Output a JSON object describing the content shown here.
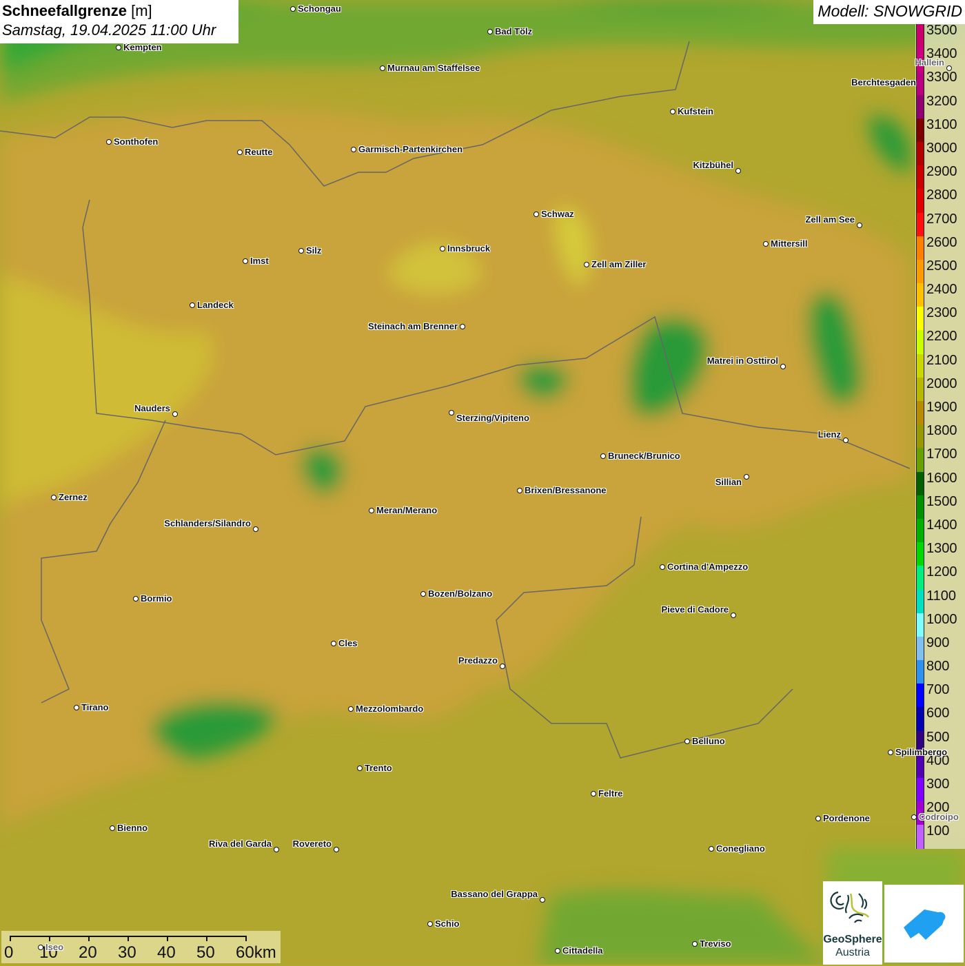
{
  "header": {
    "title_bold": "Schneefallgrenze",
    "title_unit": "[m]",
    "datetime": "Samstag, 19.04.2025 11:00 Uhr",
    "model": "Modell: SNOWGRID"
  },
  "legend": {
    "levels": [
      {
        "label": "3500",
        "color": "#c8006c"
      },
      {
        "label": "3400",
        "color": "#c8007c"
      },
      {
        "label": "3300",
        "color": "#b8007e"
      },
      {
        "label": "3200",
        "color": "#900070"
      },
      {
        "label": "3100",
        "color": "#7c0000"
      },
      {
        "label": "3000",
        "color": "#b00000"
      },
      {
        "label": "2900",
        "color": "#c80000"
      },
      {
        "label": "2800",
        "color": "#e00000"
      },
      {
        "label": "2700",
        "color": "#ff1010"
      },
      {
        "label": "2600",
        "color": "#ff7f00"
      },
      {
        "label": "2500",
        "color": "#ff9a00"
      },
      {
        "label": "2400",
        "color": "#ffc000"
      },
      {
        "label": "2300",
        "color": "#ffff00"
      },
      {
        "label": "2200",
        "color": "#ccff00"
      },
      {
        "label": "2100",
        "color": "#c8d800"
      },
      {
        "label": "2000",
        "color": "#b8b800"
      },
      {
        "label": "1900",
        "color": "#b88c00"
      },
      {
        "label": "1800",
        "color": "#989800"
      },
      {
        "label": "1700",
        "color": "#68a000"
      },
      {
        "label": "1600",
        "color": "#006000"
      },
      {
        "label": "1500",
        "color": "#009000"
      },
      {
        "label": "1400",
        "color": "#00b000"
      },
      {
        "label": "1300",
        "color": "#00d800"
      },
      {
        "label": "1200",
        "color": "#00ee80"
      },
      {
        "label": "1100",
        "color": "#00e0c0"
      },
      {
        "label": "1000",
        "color": "#80ffff"
      },
      {
        "label": "900",
        "color": "#80c0f0"
      },
      {
        "label": "800",
        "color": "#3090f0"
      },
      {
        "label": "700",
        "color": "#0000ff"
      },
      {
        "label": "600",
        "color": "#0000b0"
      },
      {
        "label": "500",
        "color": "#300080"
      },
      {
        "label": "400",
        "color": "#5000b0"
      },
      {
        "label": "300",
        "color": "#8000ff"
      },
      {
        "label": "200",
        "color": "#a000d0"
      },
      {
        "label": "100",
        "color": "#c060ff"
      }
    ]
  },
  "cities": [
    "Schongau",
    "Bad Tölz",
    "Kempten",
    "Murnau am Staffelsee",
    "Hallein",
    "Berchtesgaden",
    "Kufstein",
    "Sonthofen",
    "Reutte",
    "Garmisch-Partenkirchen",
    "Kitzbühel",
    "Schwaz",
    "Zell am See",
    "Mittersill",
    "Innsbruck",
    "Silz",
    "Imst",
    "Zell am Ziller",
    "Landeck",
    "Steinach am Brenner",
    "Matrei in Osttirol",
    "Nauders",
    "Sterzing/Vipiteno",
    "Lienz",
    "Bruneck/Brunico",
    "Sillian",
    "Zernez",
    "Brixen/Bressanone",
    "Meran/Merano",
    "Schlanders/Silandro",
    "Cortina d'Ampezzo",
    "Bormio",
    "Bozen/Bolzano",
    "Pieve di Cadore",
    "Cles",
    "Predazzo",
    "Tirano",
    "Mezzolombardo",
    "Belluno",
    "Spilimbergo",
    "Trento",
    "Feltre",
    "Pordenone",
    "Codroipo",
    "Bienno",
    "Riva del Garda",
    "Rovereto",
    "Conegliano",
    "Bassano del Grappa",
    "Schio",
    "Iseo",
    "Treviso",
    "Cittadella"
  ],
  "scale_bar": {
    "labels": [
      "0",
      "10",
      "20",
      "30",
      "40",
      "50",
      "60km"
    ]
  },
  "logos": {
    "geosphere_line1": "GeoSphere",
    "geosphere_line2": "Austria"
  }
}
